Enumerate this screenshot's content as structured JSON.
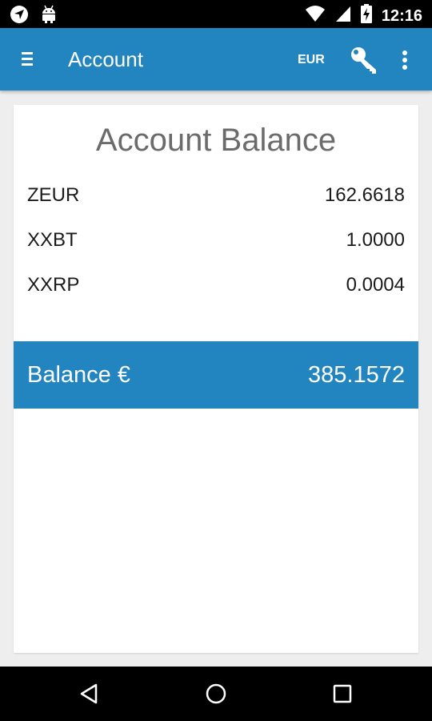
{
  "status_bar": {
    "time": "12:16",
    "icons": [
      "navigation-icon",
      "android-icon",
      "wifi-icon",
      "signal-icon",
      "battery-charging-icon"
    ]
  },
  "app_bar": {
    "title": "Account",
    "currency": "EUR",
    "icons": [
      "menu-icon",
      "key-icon",
      "more-vert-icon"
    ],
    "color": "#2385c0"
  },
  "card": {
    "title": "Account Balance",
    "balances": [
      {
        "name": "ZEUR",
        "value": "162.6618"
      },
      {
        "name": "XXBT",
        "value": "1.0000"
      },
      {
        "name": "XXRP",
        "value": "0.0004"
      }
    ],
    "total": {
      "label": "Balance €",
      "value": "385.1572"
    }
  },
  "nav_bar": {
    "icons": [
      "back-icon",
      "home-icon",
      "recents-icon"
    ]
  }
}
